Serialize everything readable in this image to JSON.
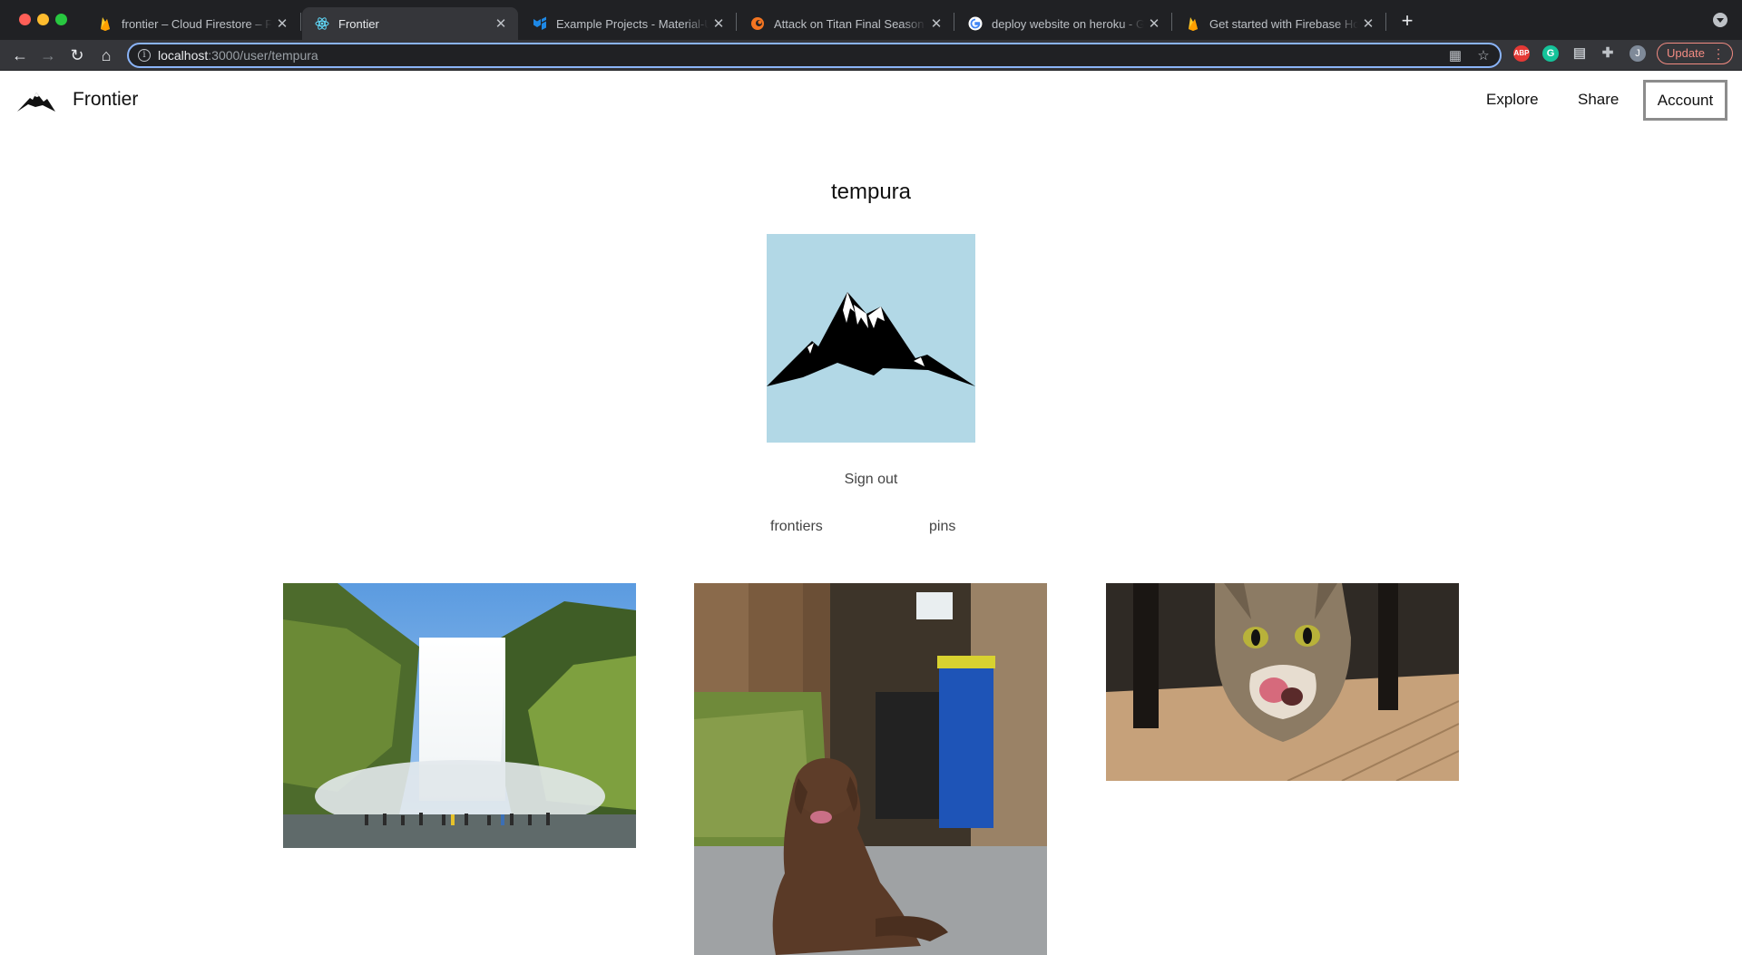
{
  "browser": {
    "tabs": [
      {
        "title": "frontier – Cloud Firestore – Fire",
        "favicon": "firebase-icon"
      },
      {
        "title": "Frontier",
        "favicon": "react-icon",
        "active": true
      },
      {
        "title": "Example Projects - Material-UI",
        "favicon": "material-ui-icon"
      },
      {
        "title": "Attack on Titan Final Season Ep",
        "favicon": "crunchyroll-icon"
      },
      {
        "title": "deploy website on heroku - Go",
        "favicon": "google-icon"
      },
      {
        "title": "Get started with Firebase Host",
        "favicon": "firebase-icon"
      }
    ],
    "url_host": "localhost",
    "url_path": ":3000/user/tempura",
    "update_label": "Update",
    "profile_initial": "J"
  },
  "header": {
    "brand": "Frontier",
    "nav": {
      "explore": "Explore",
      "share": "Share",
      "account": "Account"
    }
  },
  "profile": {
    "username": "tempura",
    "sign_out": "Sign out",
    "tabs": {
      "frontiers": "frontiers",
      "pins": "pins"
    }
  },
  "gallery": [
    {
      "subject": "waterfall"
    },
    {
      "subject": "brown dog"
    },
    {
      "subject": "tabby cat"
    }
  ],
  "colors": {
    "avatar_bg": "#b2d8e6",
    "tab_bar": "#202124",
    "toolbar": "#35363a",
    "focus_ring": "#8ab4f8",
    "update": "#f28b82"
  }
}
